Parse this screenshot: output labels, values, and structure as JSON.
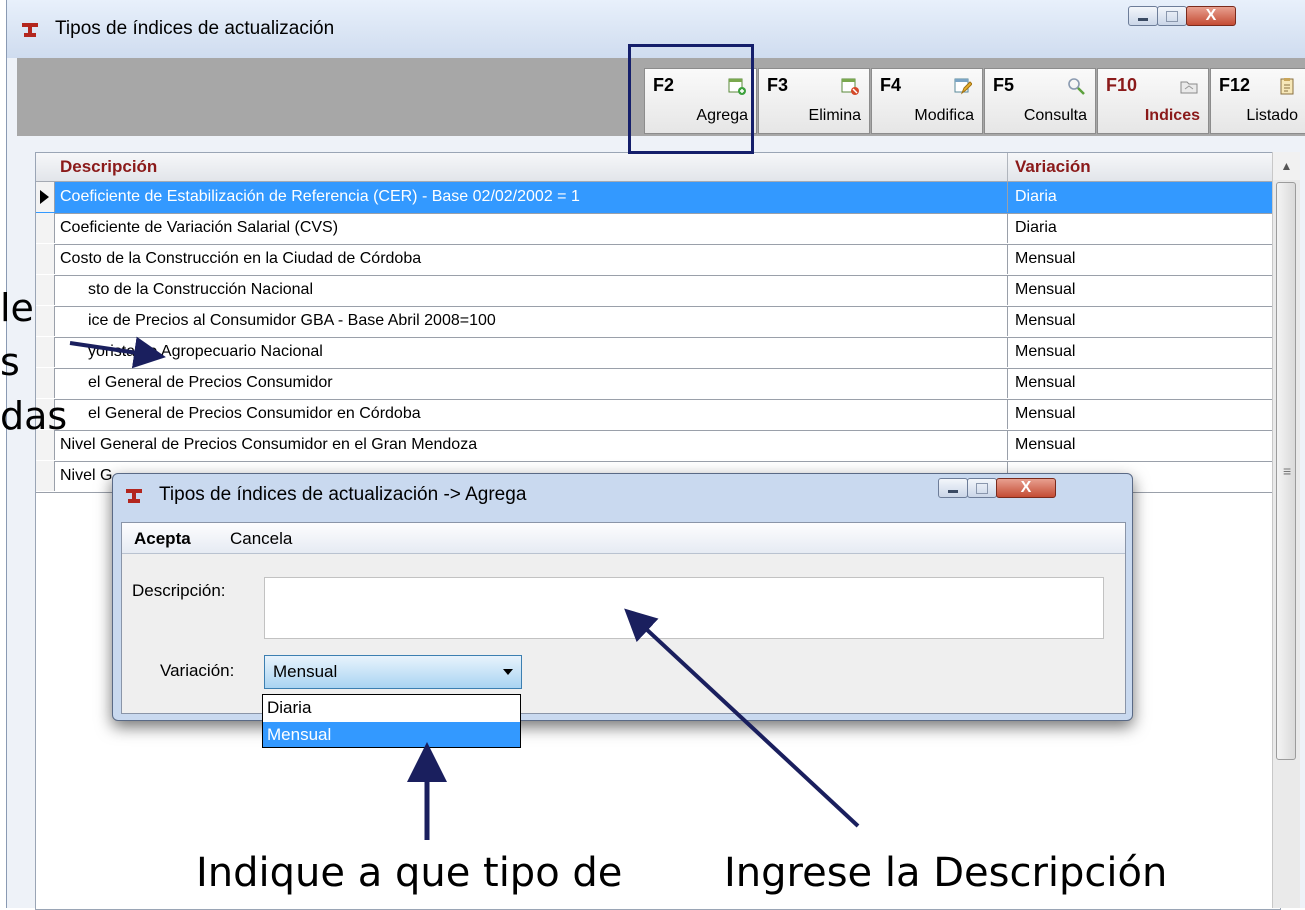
{
  "window": {
    "title": "Tipos de índices de actualización",
    "close_glyph": "X"
  },
  "toolbar": {
    "buttons": [
      {
        "key": "F2",
        "label": "Agrega",
        "icon": "add-document-icon"
      },
      {
        "key": "F3",
        "label": "Elimina",
        "icon": "delete-document-icon"
      },
      {
        "key": "F4",
        "label": "Modifica",
        "icon": "edit-document-icon"
      },
      {
        "key": "F5",
        "label": "Consulta",
        "icon": "search-icon"
      },
      {
        "key": "F10",
        "label": "Indices",
        "icon": "folder-icon"
      },
      {
        "key": "F12",
        "label": "Listado",
        "icon": "clipboard-icon"
      }
    ]
  },
  "grid": {
    "columns": {
      "description": "Descripción",
      "variation": "Variación"
    },
    "rows": [
      {
        "description": "Coeficiente de Estabilización de Referencia (CER) - Base 02/02/2002 = 1",
        "variation": "Diaria",
        "selected": true
      },
      {
        "description": "Coeficiente de Variación Salarial (CVS)",
        "variation": "Diaria"
      },
      {
        "description": "Costo de la Construcción en la Ciudad de Córdoba",
        "variation": "Mensual"
      },
      {
        "description": "sto de la Construcción Nacional",
        "variation": "Mensual"
      },
      {
        "description": "ice de Precios al Consumidor GBA - Base Abril 2008=100",
        "variation": "Mensual"
      },
      {
        "description": "yorista de Agropecuario Nacional",
        "variation": "Mensual"
      },
      {
        "description": "el General de Precios Consumidor",
        "variation": "Mensual"
      },
      {
        "description": "el General de Precios Consumidor en Córdoba",
        "variation": "Mensual"
      },
      {
        "description": "Nivel General de Precios Consumidor en el Gran Mendoza",
        "variation": "Mensual"
      },
      {
        "description": "Nivel G",
        "variation": ""
      }
    ],
    "scroll_grip": "≡",
    "scroll_up": "▲"
  },
  "dialog": {
    "title": "Tipos de índices de actualización -> Agrega",
    "close_glyph": "X",
    "menu": {
      "accept": "Acepta",
      "cancel": "Cancela"
    },
    "description_label": "Descripción:",
    "description_value": "",
    "variation_label": "Variación:",
    "variation_value": "Mensual",
    "variation_options": [
      "Diaria",
      "Mensual"
    ],
    "variation_selected_option": "Mensual"
  },
  "annotations": {
    "left_lines": [
      "le",
      "s",
      "das"
    ],
    "bottom_left": "Indique a que tipo de",
    "bottom_right": "Ingrese la Descripción",
    "arrow_color": "#1a1f5e"
  },
  "colors": {
    "selection": "#3399ff",
    "header_text": "#8b1a1a",
    "highlight_box": "#151f6b"
  }
}
